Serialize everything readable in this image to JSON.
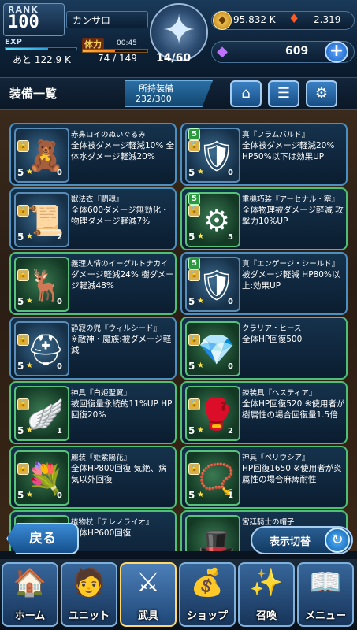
{
  "header": {
    "rank_label": "RANK",
    "rank_value": "100",
    "player_name": "カンサロ",
    "exp_label": "EXP",
    "exp_remaining": "あと 122.9 K",
    "stamina_label": "体力",
    "stamina_timer": "00:45",
    "stamina_value": "74 / 149",
    "floor_value": "14/60",
    "gold_value": "95.832 K",
    "fire_value": "2.319",
    "gem_value": "609",
    "gem_add_label": "+"
  },
  "titlebar": {
    "title": "装備一覧",
    "owned_label": "所持装備",
    "owned_value": "232/300",
    "buttons": [
      "tag-icon",
      "sort-icon",
      "settings-icon"
    ]
  },
  "items": [
    {
      "name": "赤鼻ロイのぬいぐるみ",
      "desc": "全体被ダメージ軽減10% 全体水ダメージ軽減20%",
      "level": "5",
      "count": "0",
      "lock": true,
      "top_level": ""
    },
    {
      "name": "真『フラムバルド』",
      "desc": "全体被ダメージ軽減20% HP50%以下は効果UP",
      "level": "5",
      "count": "0",
      "lock": true,
      "top_level": "5"
    },
    {
      "name": "獣法衣『闘魂』",
      "desc": "全体600ダメージ無効化・物理ダメージ軽減7%",
      "level": "5",
      "count": "2",
      "lock": true,
      "top_level": ""
    },
    {
      "name": "重機巧装『アーセナル・塞』",
      "desc": "全体物理被ダメージ軽減 攻撃力10%UP",
      "level": "5",
      "count": "5",
      "lock": true,
      "top_level": "5"
    },
    {
      "name": "義理人情のイーグルトナカイ",
      "desc": "ダメージ軽減24% 樹ダメージ軽減48%",
      "level": "5",
      "count": "0",
      "lock": true,
      "top_level": ""
    },
    {
      "name": "真『エンゲージ・シールド』",
      "desc": "被ダメージ軽減 HP80%以上:効果UP",
      "level": "5",
      "count": "0",
      "lock": true,
      "top_level": "5"
    },
    {
      "name": "静寂の兜『ウィルシード』",
      "desc": "※敵神・魔族:被ダメージ軽減",
      "level": "5",
      "count": "0",
      "lock": true,
      "top_level": ""
    },
    {
      "name": "クラリア・ヒース",
      "desc": "全体HP回復500",
      "level": "5",
      "count": "0",
      "lock": true,
      "top_level": ""
    },
    {
      "name": "神具『白姫聖翼』",
      "desc": "被回復量永続的11%UP HP回復20%",
      "level": "5",
      "count": "1",
      "lock": true,
      "top_level": ""
    },
    {
      "name": "錬装具『ヘスティア』",
      "desc": "全体HP回復520 ※使用者が樹属性の場合回復量1.5倍",
      "level": "5",
      "count": "2",
      "lock": true,
      "top_level": ""
    },
    {
      "name": "麗装『姫紫陽花』",
      "desc": "全体HP800回復 気絶、病気以外回復",
      "level": "5",
      "count": "0",
      "lock": true,
      "top_level": ""
    },
    {
      "name": "神具『ペリウシア』",
      "desc": "HP回復1650 ※使用者が炎属性の場合麻痺耐性",
      "level": "5",
      "count": "1",
      "lock": true,
      "top_level": ""
    },
    {
      "name": "植物杖『テレノライオ』",
      "desc": "全体HP600回復",
      "level": "",
      "count": "",
      "lock": false,
      "top_level": ""
    },
    {
      "name": "宮廷騎士の帽子",
      "desc": "",
      "level": "",
      "count": "",
      "lock": false,
      "top_level": ""
    }
  ],
  "controls": {
    "back_label": "戻る",
    "toggle_label": "表示切替"
  },
  "nav": [
    {
      "label": "ホーム",
      "icon": "home-icon"
    },
    {
      "label": "ユニット",
      "icon": "unit-icon"
    },
    {
      "label": "武具",
      "icon": "sword-icon"
    },
    {
      "label": "ショップ",
      "icon": "shop-icon"
    },
    {
      "label": "召喚",
      "icon": "summon-icon"
    },
    {
      "label": "メニュー",
      "icon": "menu-book-icon"
    }
  ],
  "progress": {
    "exp_fraction": 0.6,
    "stamina_fraction": 0.5
  }
}
